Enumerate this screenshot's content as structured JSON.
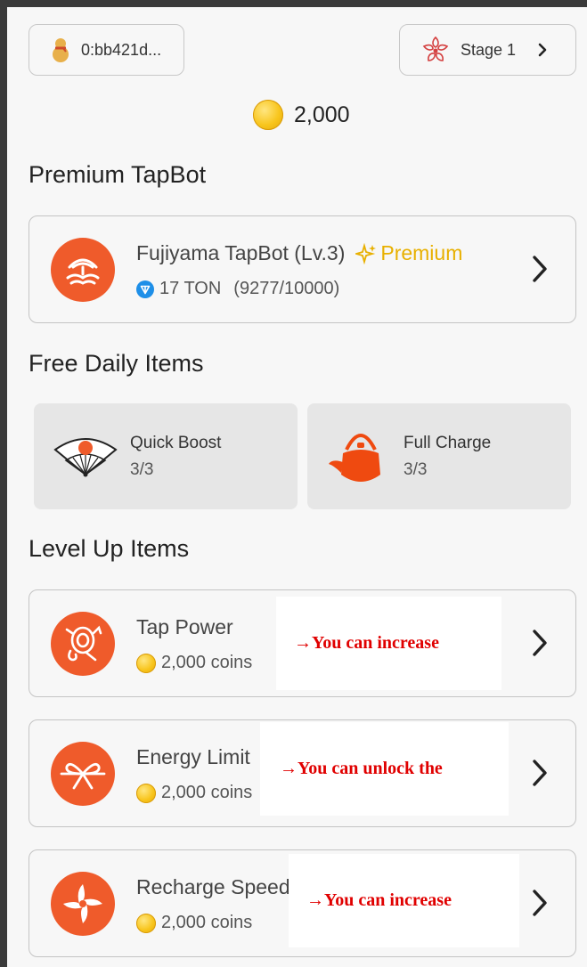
{
  "header": {
    "wallet_label": "0:bb421d...",
    "stage_label": "Stage 1"
  },
  "balance": {
    "amount": "2,000"
  },
  "premium": {
    "section_title": "Premium TapBot",
    "item": {
      "name": "Fujiyama TapBot (Lv.3)",
      "badge": "Premium",
      "price": "17 TON",
      "progress": "(9277/10000)"
    }
  },
  "daily": {
    "section_title": "Free Daily Items",
    "items": [
      {
        "label": "Quick Boost",
        "count": "3/3"
      },
      {
        "label": "Full Charge",
        "count": "3/3"
      }
    ]
  },
  "levelup": {
    "section_title": "Level Up Items",
    "items": [
      {
        "label": "Tap Power",
        "cost": "2,000 coins",
        "note": "→You can increase"
      },
      {
        "label": "Energy Limit",
        "cost": "2,000 coins",
        "note": "→You can unlock the"
      },
      {
        "label": "Recharge Speed",
        "cost": "2,000 coins",
        "note": "→You can increase"
      }
    ]
  },
  "colors": {
    "accent": "#ef5b2b",
    "premium": "#e8b000",
    "note_text": "#e00000"
  }
}
